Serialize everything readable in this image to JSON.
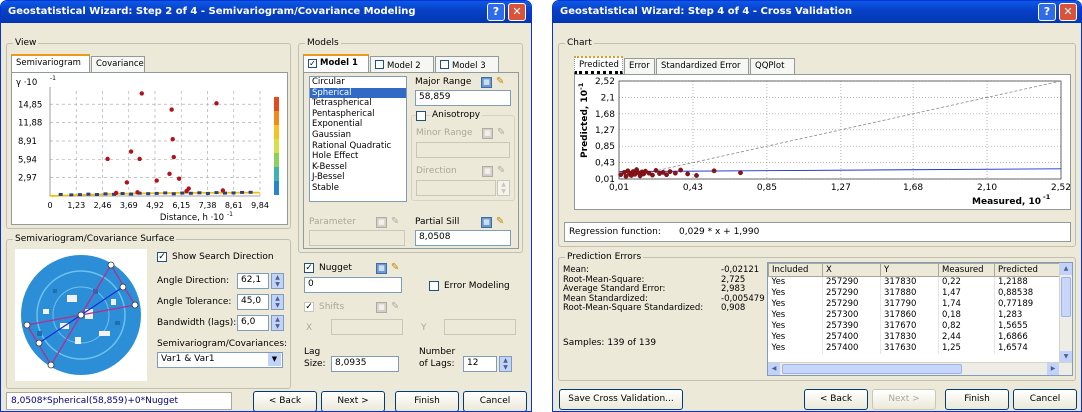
{
  "w1": {
    "title": "Geostatistical Wizard: Step 2 of 4 - Semivariogram/Covariance Modeling",
    "help": "?",
    "close": "✕",
    "view": {
      "label": "View",
      "tabs": [
        "Semivariogram",
        "Covariance"
      ],
      "gamma_label": "γ ·10",
      "gamma_exp": "-1",
      "xlabel": "Distance, h ·10",
      "xlabel_exp": "-1"
    },
    "models": {
      "label": "Models",
      "tabs": [
        "Model 1",
        "Model 2",
        "Model 3"
      ],
      "list": [
        "Circular",
        "Spherical",
        "Tetraspherical",
        "Pentaspherical",
        "Exponential",
        "Gaussian",
        "Rational Quadratic",
        "Hole Effect",
        "K-Bessel",
        "J-Bessel",
        "Stable"
      ],
      "selected": "Spherical",
      "major_range_label": "Major Range",
      "major_range_value": "58,859",
      "anisotropy": "Anisotropy",
      "minor_range": "Minor Range",
      "direction": "Direction",
      "parameter": "Parameter",
      "partial_sill_label": "Partial Sill",
      "partial_sill_value": "8,0508",
      "nugget": "Nugget",
      "nugget_value": "0",
      "error_modeling": "Error Modeling",
      "shifts": "Shifts",
      "x": "X",
      "y": "Y",
      "lag_size_label1": "Lag",
      "lag_size_label2": "Size:",
      "lag_size_value": "8,0935",
      "num_lags_label1": "Number",
      "num_lags_label2": "of Lags:",
      "num_lags_value": "12"
    },
    "surface": {
      "label": "Semivariogram/Covariance Surface",
      "show_search": "Show Search Direction",
      "angle_direction_label": "Angle Direction:",
      "angle_direction_value": "62,1",
      "angle_tolerance_label": "Angle Tolerance:",
      "angle_tolerance_value": "45,0",
      "bandwidth_label": "Bandwidth (lags):",
      "bandwidth_value": "6,0",
      "semivar_cov_label": "Semivariogram/Covariances:",
      "semivar_cov_value": "Var1 & Var1"
    },
    "status": "8,0508*Spherical(58,859)+0*Nugget",
    "buttons": {
      "back": "< Back",
      "next": "Next >",
      "finish": "Finish",
      "cancel": "Cancel"
    }
  },
  "w2": {
    "title": "Geostatistical Wizard: Step 4 of 4 - Cross Validation",
    "help": "?",
    "close": "✕",
    "chart_group": "Chart",
    "tabs": [
      "Predicted",
      "Error",
      "Standardized Error",
      "QQPlot"
    ],
    "ylabel": "Predicted, 10",
    "ylabel_exp": "-1",
    "xlabel": "Measured, 10",
    "xlabel_exp": "-1",
    "regression_label": "Regression function:",
    "regression_value": "0,029 * x + 1,990",
    "pred_errors": {
      "label": "Prediction Errors",
      "rows": [
        {
          "k": "Mean:",
          "v": "-0,02121"
        },
        {
          "k": "Root-Mean-Square:",
          "v": "2,725"
        },
        {
          "k": "Average Standard Error:",
          "v": "2,983"
        },
        {
          "k": "Mean Standardized:",
          "v": "-0,005479"
        },
        {
          "k": "Root-Mean-Square Standardized:",
          "v": "0,908"
        }
      ],
      "samples": "Samples: 139 of 139"
    },
    "table": {
      "columns": [
        "Included",
        "X",
        "Y",
        "Measured",
        "Predicted"
      ],
      "rows": [
        [
          "Yes",
          "257290",
          "317830",
          "0,22",
          "1,2188"
        ],
        [
          "Yes",
          "257290",
          "317880",
          "1,47",
          "0,88538"
        ],
        [
          "Yes",
          "257290",
          "317790",
          "1,74",
          "0,77189"
        ],
        [
          "Yes",
          "257300",
          "317860",
          "0,18",
          "1,283"
        ],
        [
          "Yes",
          "257390",
          "317670",
          "0,82",
          "1,5655"
        ],
        [
          "Yes",
          "257400",
          "317830",
          "2,44",
          "1,6866"
        ],
        [
          "Yes",
          "257400",
          "317630",
          "1,25",
          "1,6574"
        ]
      ]
    },
    "buttons": {
      "save": "Save Cross Validation...",
      "back": "< Back",
      "next": "Next >",
      "finish": "Finish",
      "cancel": "Cancel"
    }
  },
  "chart_data": [
    {
      "type": "scatter",
      "title": "",
      "xlabel": "Distance, h ·10^-1",
      "ylabel": "γ ·10^-1",
      "x_ticks": [
        "0",
        "1,23",
        "2,46",
        "3,69",
        "4,92",
        "6,15",
        "7,38",
        "8,61",
        "9,84"
      ],
      "y_ticks": [
        "2,97",
        "5,94",
        "8,91",
        "11,88",
        "14,85"
      ],
      "xlim": [
        0,
        9.84
      ],
      "ylim": [
        0,
        17.0
      ],
      "grid": true,
      "series": [
        {
          "x": [
            4.3,
            5.7,
            5.75,
            7.8,
            2.7,
            3.8,
            4.2,
            5.8,
            5.6,
            6.05,
            3.6,
            5.0,
            6.5,
            6.4,
            4.1,
            3.1,
            8.1
          ],
          "y": [
            16.6,
            14.0,
            9.2,
            15.0,
            6.0,
            7.2,
            6.0,
            6.3,
            3.6,
            2.8,
            2.2,
            2.5,
            1.2,
            0.8,
            0.6,
            0.5,
            0.9
          ]
        },
        {
          "x": [
            0.5,
            1.0,
            1.4,
            1.8,
            2.2,
            2.6,
            3.0,
            3.4,
            3.8,
            4.2,
            4.6,
            5.0,
            5.4,
            5.8,
            6.2,
            6.6,
            7.0,
            7.4,
            7.8,
            8.2,
            8.6,
            9.0,
            9.4
          ],
          "y": [
            0.25,
            0.18,
            0.22,
            0.3,
            0.24,
            0.35,
            0.28,
            0.4,
            0.32,
            0.45,
            0.38,
            0.42,
            0.5,
            0.36,
            0.48,
            0.44,
            0.52,
            0.41,
            0.55,
            0.47,
            0.5,
            0.58,
            0.6
          ]
        }
      ]
    },
    {
      "type": "scatter",
      "title": "",
      "xlabel": "Measured, 10^-1",
      "ylabel": "Predicted, 10^-1",
      "x_ticks": [
        "0,01",
        "0,43",
        "0,85",
        "1,27",
        "1,68",
        "2,10",
        "2,52"
      ],
      "y_ticks": [
        "0,01",
        "0,43",
        "0,85",
        "1,27",
        "1,68",
        "2,1",
        "2,52"
      ],
      "xlim": [
        0.01,
        2.52
      ],
      "ylim": [
        0.01,
        2.52
      ],
      "grid": true,
      "regression": {
        "slope": 0.029,
        "intercept": 0.199
      },
      "reference_line": "y = x",
      "series": [
        {
          "x": [
            0.02,
            0.04,
            0.05,
            0.06,
            0.07,
            0.08,
            0.09,
            0.1,
            0.11,
            0.12,
            0.13,
            0.14,
            0.15,
            0.16,
            0.18,
            0.2,
            0.22,
            0.24,
            0.26,
            0.28,
            0.3,
            0.33,
            0.36,
            0.4,
            0.45,
            0.55,
            0.7
          ],
          "y": [
            0.12,
            0.18,
            0.08,
            0.22,
            0.15,
            0.1,
            0.2,
            0.13,
            0.25,
            0.17,
            0.09,
            0.19,
            0.14,
            0.21,
            0.16,
            0.11,
            0.23,
            0.15,
            0.18,
            0.12,
            0.2,
            0.16,
            0.24,
            0.14,
            0.1,
            0.22,
            0.17
          ]
        }
      ]
    }
  ]
}
